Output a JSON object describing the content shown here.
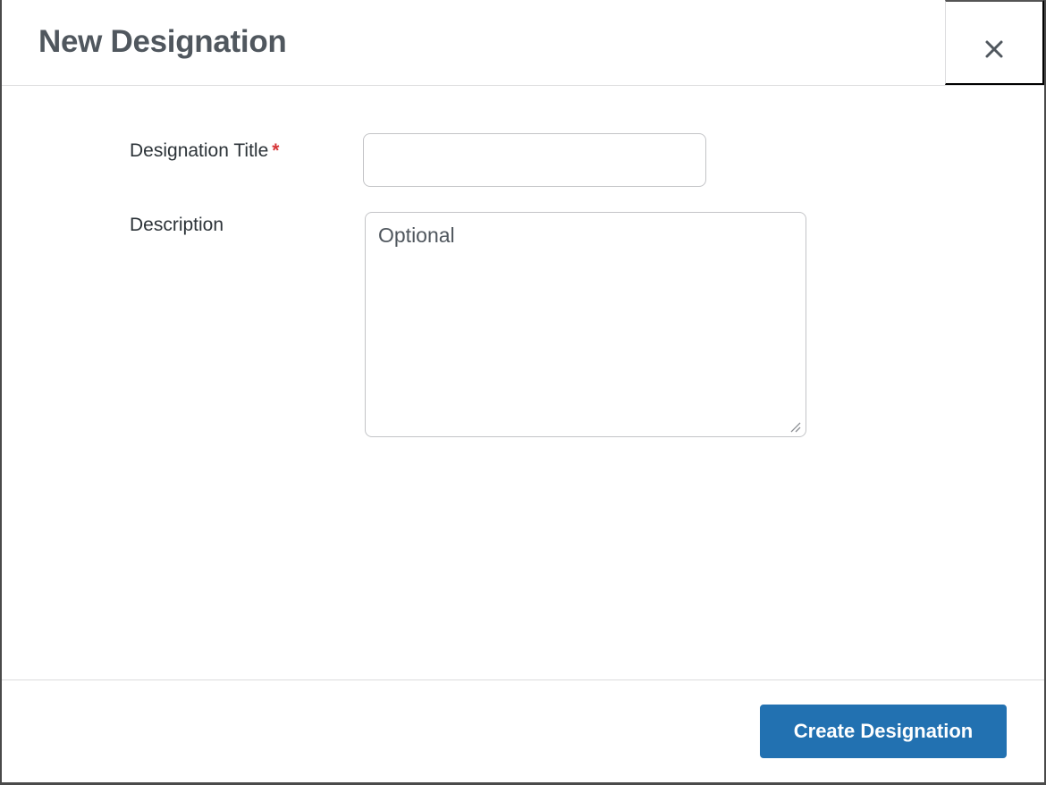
{
  "modal": {
    "title": "New Designation",
    "close_icon": "close-icon"
  },
  "form": {
    "title_field": {
      "label": "Designation Title",
      "required_marker": "*",
      "value": ""
    },
    "description_field": {
      "label": "Description",
      "placeholder": "Optional",
      "value": ""
    }
  },
  "footer": {
    "submit_label": "Create Designation"
  },
  "colors": {
    "primary": "#2271b1",
    "required": "#d63638",
    "title_text": "#50575e"
  }
}
